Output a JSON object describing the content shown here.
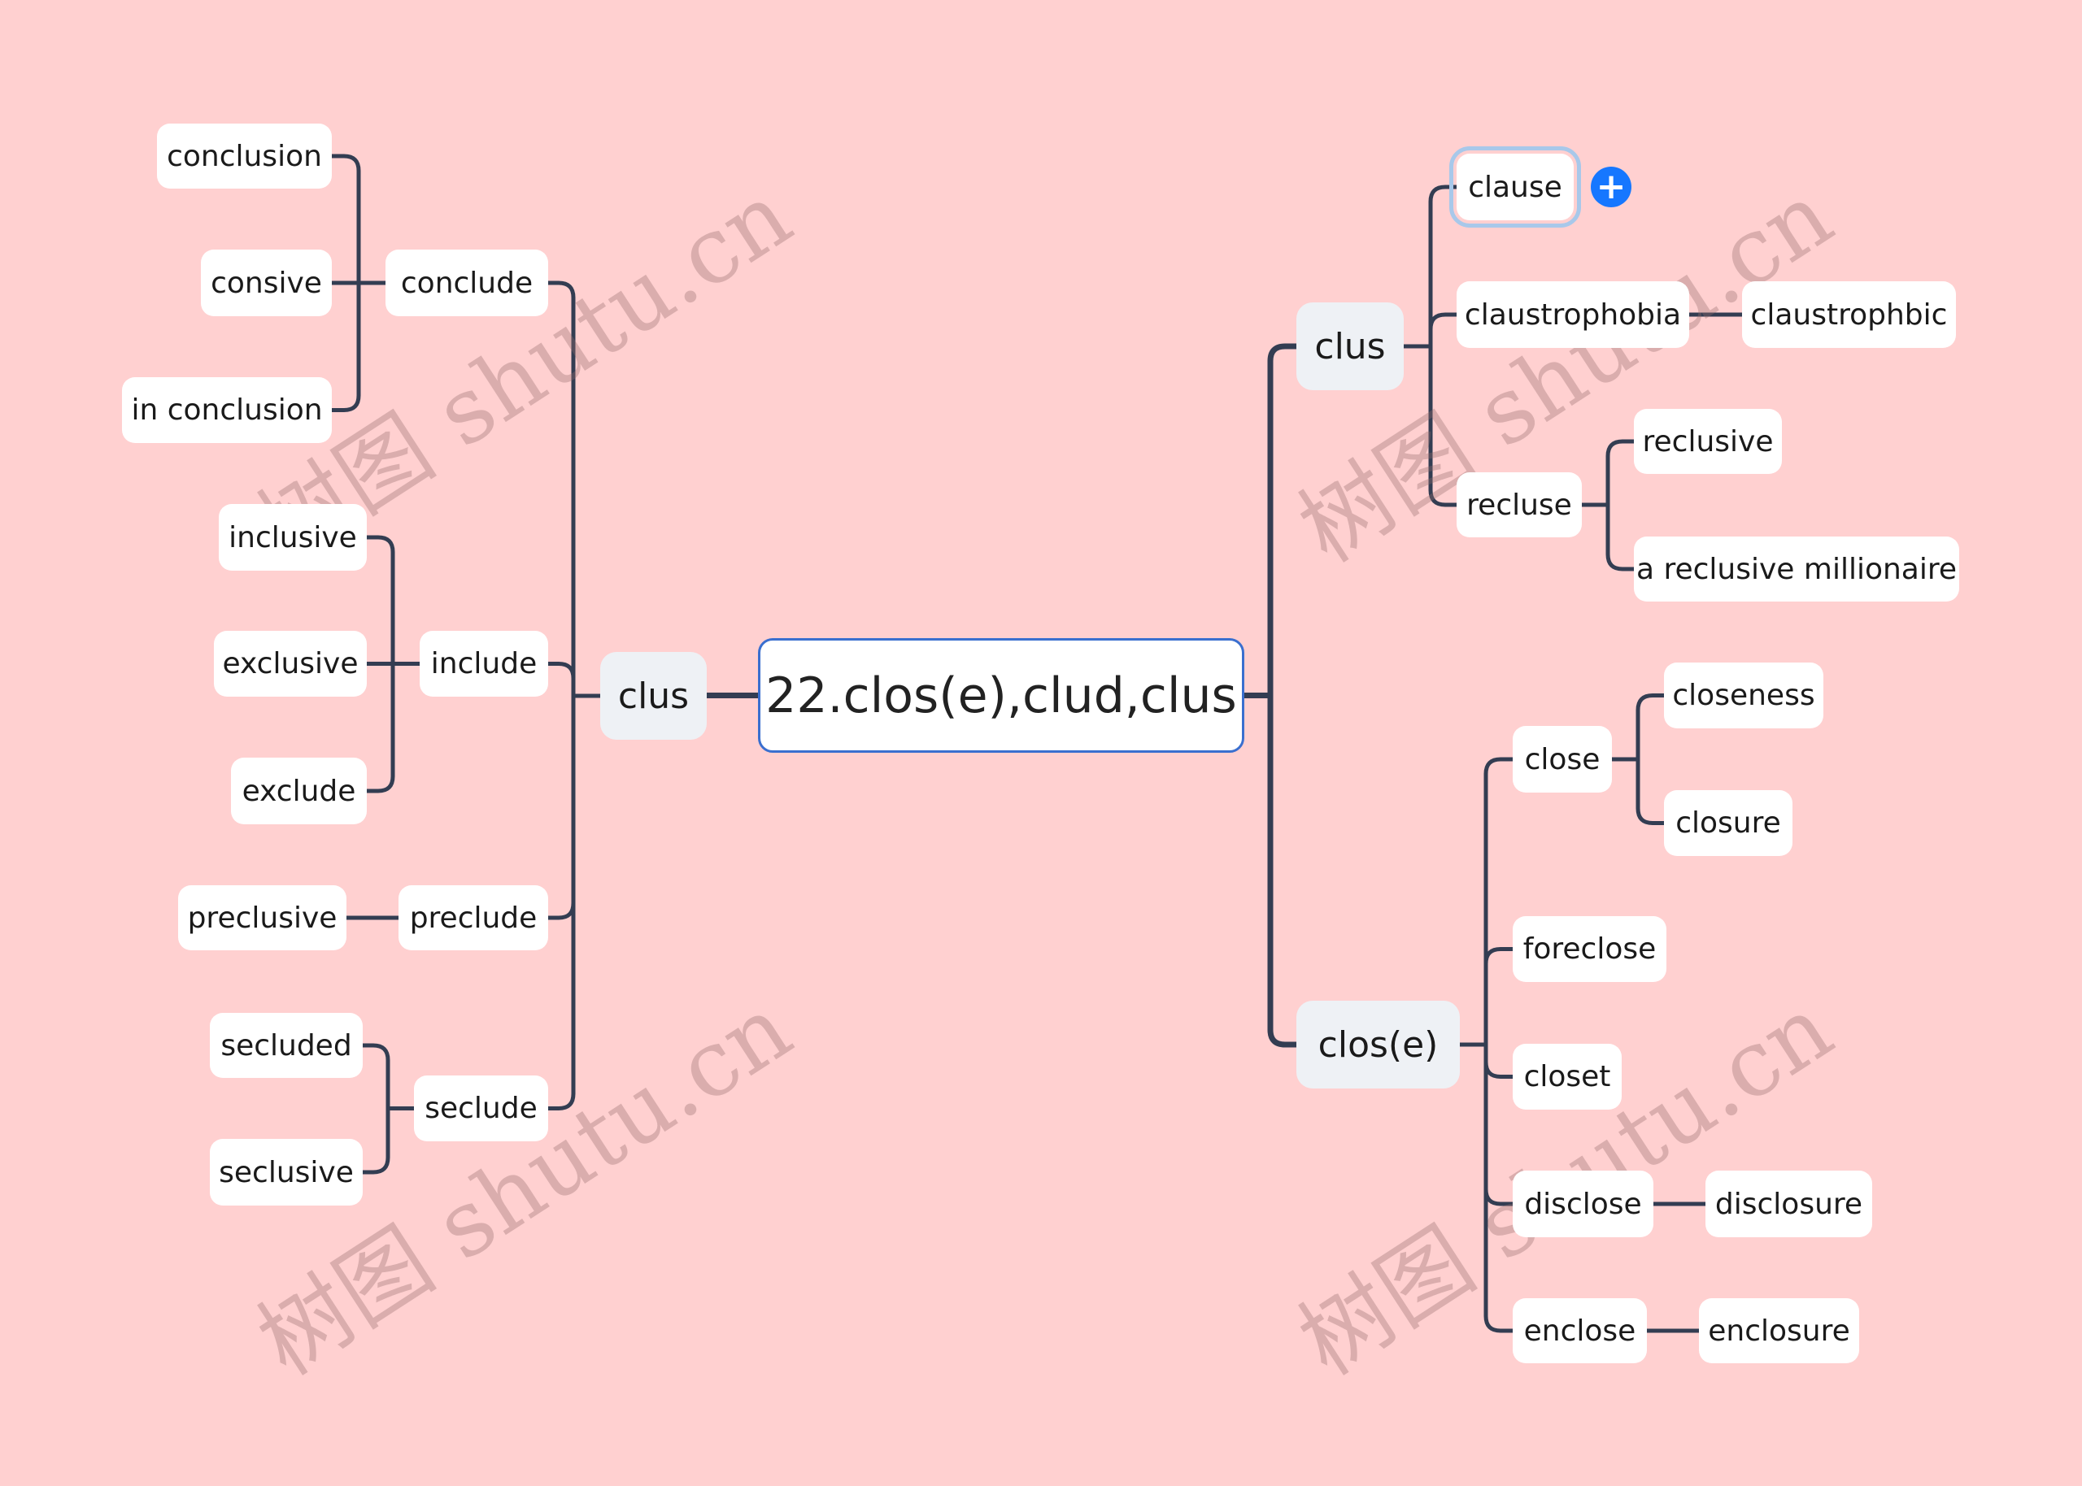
{
  "root": {
    "label": "22.clos(e),clud,clus"
  },
  "colors": {
    "background": "#ffd0d0",
    "link": "#333d52",
    "root_border": "#3a6fcf",
    "main_fill": "#eef1f5",
    "node_fill": "#ffffff",
    "selection_ring": "#a8c8ea",
    "add_button": "#1677ff"
  },
  "left": {
    "main": {
      "label": "clus"
    },
    "branches": [
      {
        "label": "conclude",
        "children": [
          {
            "label": "conclusion"
          },
          {
            "label": "consive"
          },
          {
            "label": "in conclusion"
          }
        ]
      },
      {
        "label": "include",
        "children": [
          {
            "label": "inclusive"
          },
          {
            "label": "exclusive"
          },
          {
            "label": "exclude"
          }
        ]
      },
      {
        "label": "preclude",
        "children": [
          {
            "label": "preclusive"
          }
        ]
      },
      {
        "label": "seclude",
        "children": [
          {
            "label": "secluded"
          },
          {
            "label": "seclusive"
          }
        ]
      }
    ]
  },
  "right": {
    "clus": {
      "label": "clus",
      "branches": [
        {
          "label": "clause",
          "selected": true,
          "children": []
        },
        {
          "label": "claustrophobia",
          "children": [
            {
              "label": "claustrophbic"
            }
          ]
        },
        {
          "label": "recluse",
          "children": [
            {
              "label": "reclusive"
            },
            {
              "label": "a reclusive millionaire"
            }
          ]
        }
      ]
    },
    "close": {
      "label": "clos(e)",
      "branches": [
        {
          "label": "close",
          "children": [
            {
              "label": "closeness"
            },
            {
              "label": "closure"
            }
          ]
        },
        {
          "label": "foreclose",
          "children": []
        },
        {
          "label": "closet",
          "children": []
        },
        {
          "label": "disclose",
          "children": [
            {
              "label": "disclosure"
            }
          ]
        },
        {
          "label": "enclose",
          "children": [
            {
              "label": "enclosure"
            }
          ]
        }
      ]
    }
  },
  "add_button": {
    "icon": "plus-icon",
    "glyph": "+"
  },
  "watermark": {
    "text": "树图 shutu.cn"
  }
}
